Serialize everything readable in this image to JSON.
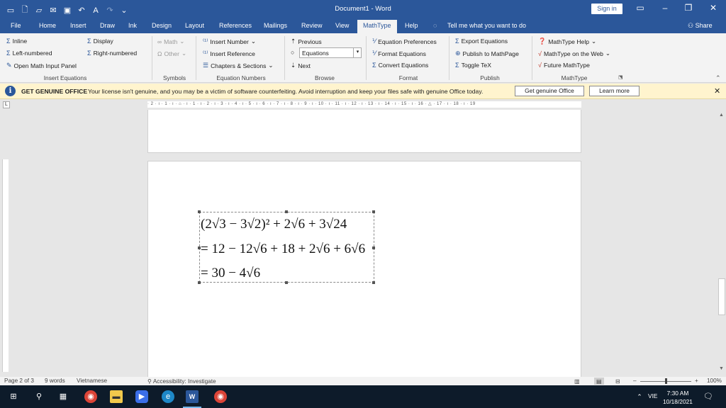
{
  "window": {
    "title": "Document1 - Word",
    "signin": "Sign in",
    "share": "Share"
  },
  "tabs": [
    "File",
    "Home",
    "Insert",
    "Draw",
    "Ink",
    "Design",
    "Layout",
    "References",
    "Mailings",
    "Review",
    "View",
    "MathType",
    "Help"
  ],
  "active_tab": "MathType",
  "tellme": "Tell me what you want to do",
  "ribbon": {
    "inline": "Inline",
    "display": "Display",
    "left_numbered": "Left-numbered",
    "right_numbered": "Right-numbered",
    "open_math_input": "Open Math Input Panel",
    "group_insert_equations": "Insert Equations",
    "math": "Math",
    "other": "Other",
    "group_symbols": "Symbols",
    "insert_number": "Insert Number",
    "insert_reference": "Insert Reference",
    "chapters_sections": "Chapters & Sections",
    "group_equation_numbers": "Equation Numbers",
    "previous": "Previous",
    "equations_value": "Equations",
    "next": "Next",
    "group_browse": "Browse",
    "equation_preferences": "Equation Preferences",
    "format_equations": "Format Equations",
    "convert_equations": "Convert Equations",
    "group_format": "Format",
    "export_equations": "Export Equations",
    "publish_mathpage": "Publish to MathPage",
    "toggle_tex": "Toggle TeX",
    "group_publish": "Publish",
    "mathtype_help": "MathType Help",
    "mathtype_web": "MathType on the Web",
    "future_mathtype": "Future MathType",
    "group_mathtype": "MathType"
  },
  "message": {
    "title": "GET GENUINE OFFICE",
    "text": "Your license isn't genuine, and you may be a victim of software counterfeiting. Avoid interruption and keep your files safe with genuine Office today.",
    "btn_genuine": "Get genuine Office",
    "btn_learn": "Learn more"
  },
  "ruler_text": "· 2 · ı · 1 · ı · ⌂ · ı · 1 · ı · 2 · ı · 3 · ı · 4 · ı · 5 · ı · 6 · ı · 7 · ı · 8 · ı · 9 · ı · 10 · ı · 11 · ı · 12 · ı · 13 · ı · 14 · ı · 15 · ı · 16 · △ · 17 · ı · 18 · ı · 19",
  "equations": [
    "(2√3 − 3√2)² + 2√6 + 3√24",
    "= 12 − 12√6 + 18 + 2√6 + 6√6",
    "= 30 − 4√6"
  ],
  "status": {
    "page": "Page 2 of 3",
    "words": "9 words",
    "language": "Vietnamese",
    "accessibility": "Accessibility: Investigate",
    "zoom": "100%"
  },
  "taskbar": {
    "time": "7:30 AM",
    "date": "10/18/2021",
    "lang": "VIE"
  },
  "colors": {
    "word_blue": "#2b579a",
    "message_bg": "#fff4ce",
    "taskbar": "#0d1b2a"
  }
}
